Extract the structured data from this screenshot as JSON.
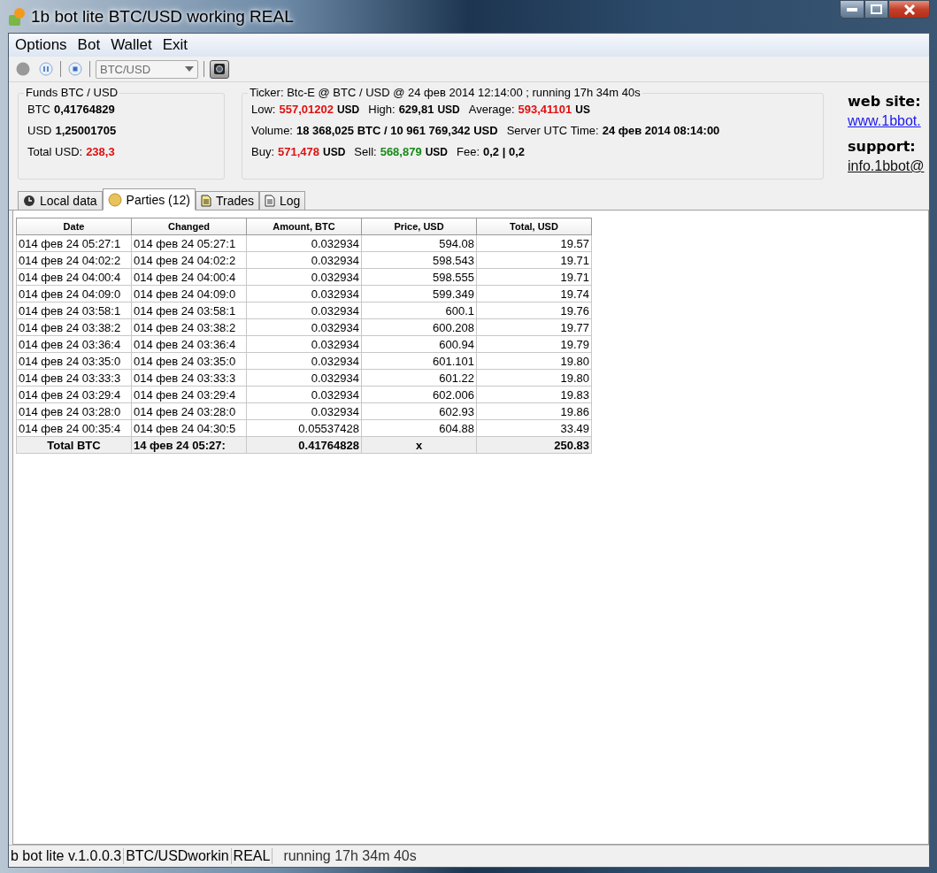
{
  "window": {
    "title": "1b bot lite BTC/USD working REAL"
  },
  "menu": [
    "Options",
    "Bot",
    "Wallet",
    "Exit"
  ],
  "toolbar": {
    "pair": "BTC/USD"
  },
  "funds": {
    "title": "Funds BTC / USD",
    "lines": [
      {
        "label": "BTC",
        "value": "0,41764829",
        "color": "#000000"
      },
      {
        "label": "USD",
        "value": "1,25001705",
        "color": "#000000"
      },
      {
        "label": "Total USD:",
        "value": "238,3",
        "color": "#e01010"
      }
    ]
  },
  "ticker": {
    "title": "Ticker: Btc-E @ BTC / USD @ 24 фев 2014 12:14:00 ; running 17h 34m 40s",
    "rows": [
      [
        {
          "label": "Low:",
          "value": "557,01202",
          "unit": "USD",
          "color": "#e01010"
        },
        {
          "label": "High:",
          "value": "629,81",
          "unit": "USD",
          "color": "#000000"
        },
        {
          "label": "Average:",
          "value": "593,41101",
          "unit": "US",
          "color": "#e01010"
        }
      ],
      [
        {
          "label": "Volume:",
          "value": "18 368,025 BTC / 10 961 769,342 USD",
          "color": "#000000"
        },
        {
          "label": "Server UTC Time:",
          "value": "24 фев 2014 08:14:00",
          "color": "#000000"
        }
      ],
      [
        {
          "label": "Buy:",
          "value": "571,478",
          "unit": "USD",
          "color": "#e01010"
        },
        {
          "label": "Sell:",
          "value": "568,879",
          "unit": "USD",
          "color": "#178a17"
        },
        {
          "label": "Fee:",
          "value": "0,2 | 0,2",
          "color": "#000000"
        }
      ]
    ]
  },
  "contacts": [
    {
      "heading": "web site:",
      "link": "www.1bbot.",
      "kind": "web"
    },
    {
      "heading": "support:",
      "link": "info.1bbot@",
      "kind": "mail"
    }
  ],
  "tabs": [
    {
      "label": "Local data",
      "selected": false
    },
    {
      "label": "Parties (12)",
      "selected": true
    },
    {
      "label": "Trades",
      "selected": false
    },
    {
      "label": "Log",
      "selected": false
    }
  ],
  "table": {
    "columns": [
      "Date",
      "Changed",
      "Amount, BTC",
      "Price, USD",
      "Total, USD"
    ],
    "rows": [
      [
        "014 фев 24 05:27:1",
        "014 фев 24 05:27:1",
        "0.032934",
        "594.08",
        "19.57"
      ],
      [
        "014 фев 24 04:02:2",
        "014 фев 24 04:02:2",
        "0.032934",
        "598.543",
        "19.71"
      ],
      [
        "014 фев 24 04:00:4",
        "014 фев 24 04:00:4",
        "0.032934",
        "598.555",
        "19.71"
      ],
      [
        "014 фев 24 04:09:0",
        "014 фев 24 04:09:0",
        "0.032934",
        "599.349",
        "19.74"
      ],
      [
        "014 фев 24 03:58:1",
        "014 фев 24 03:58:1",
        "0.032934",
        "600.1",
        "19.76"
      ],
      [
        "014 фев 24 03:38:2",
        "014 фев 24 03:38:2",
        "0.032934",
        "600.208",
        "19.77"
      ],
      [
        "014 фев 24 03:36:4",
        "014 фев 24 03:36:4",
        "0.032934",
        "600.94",
        "19.79"
      ],
      [
        "014 фев 24 03:35:0",
        "014 фев 24 03:35:0",
        "0.032934",
        "601.101",
        "19.80"
      ],
      [
        "014 фев 24 03:33:3",
        "014 фев 24 03:33:3",
        "0.032934",
        "601.22",
        "19.80"
      ],
      [
        "014 фев 24 03:29:4",
        "014 фев 24 03:29:4",
        "0.032934",
        "602.006",
        "19.83"
      ],
      [
        "014 фев 24 03:28:0",
        "014 фев 24 03:28:0",
        "0.032934",
        "602.93",
        "19.86"
      ],
      [
        "014 фев 24 00:35:4",
        "014 фев 24 04:30:5",
        "0.05537428",
        "604.88",
        "33.49"
      ]
    ],
    "total": [
      "Total BTC",
      "14 фев 24 05:27:",
      "0.41764828",
      "x",
      "250.83"
    ]
  },
  "status_bar": [
    "b bot lite v.1.0.0.3",
    "BTC/USDworkin",
    "REAL",
    "running 17h 34m 40s"
  ]
}
